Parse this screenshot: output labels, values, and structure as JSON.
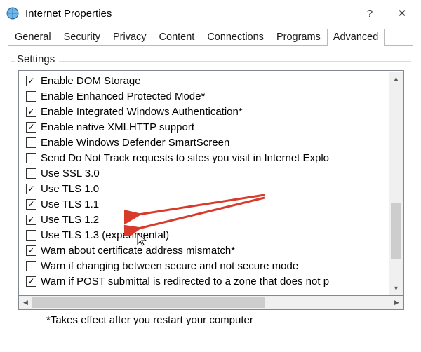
{
  "titlebar": {
    "title": "Internet Properties",
    "help": "?",
    "close": "✕"
  },
  "tabs": [
    "General",
    "Security",
    "Privacy",
    "Content",
    "Connections",
    "Programs",
    "Advanced"
  ],
  "active_tab_index": 6,
  "group_label": "Settings",
  "items": [
    {
      "checked": true,
      "label": "Enable DOM Storage"
    },
    {
      "checked": false,
      "label": "Enable Enhanced Protected Mode*"
    },
    {
      "checked": true,
      "label": "Enable Integrated Windows Authentication*"
    },
    {
      "checked": true,
      "label": "Enable native XMLHTTP support"
    },
    {
      "checked": false,
      "label": "Enable Windows Defender SmartScreen"
    },
    {
      "checked": false,
      "label": "Send Do Not Track requests to sites you visit in Internet Explo"
    },
    {
      "checked": false,
      "label": "Use SSL 3.0"
    },
    {
      "checked": true,
      "label": "Use TLS 1.0"
    },
    {
      "checked": true,
      "label": "Use TLS 1.1"
    },
    {
      "checked": true,
      "label": "Use TLS 1.2"
    },
    {
      "checked": false,
      "label": "Use TLS 1.3 (experimental)"
    },
    {
      "checked": true,
      "label": "Warn about certificate address mismatch*"
    },
    {
      "checked": false,
      "label": "Warn if changing between secure and not secure mode"
    },
    {
      "checked": true,
      "label": "Warn if POST submittal is redirected to a zone that does not p"
    }
  ],
  "note": "*Takes effect after you restart your computer",
  "checkmark": "✓",
  "arrows": {
    "up": "▲",
    "down": "▼",
    "left": "◀",
    "right": "▶"
  }
}
